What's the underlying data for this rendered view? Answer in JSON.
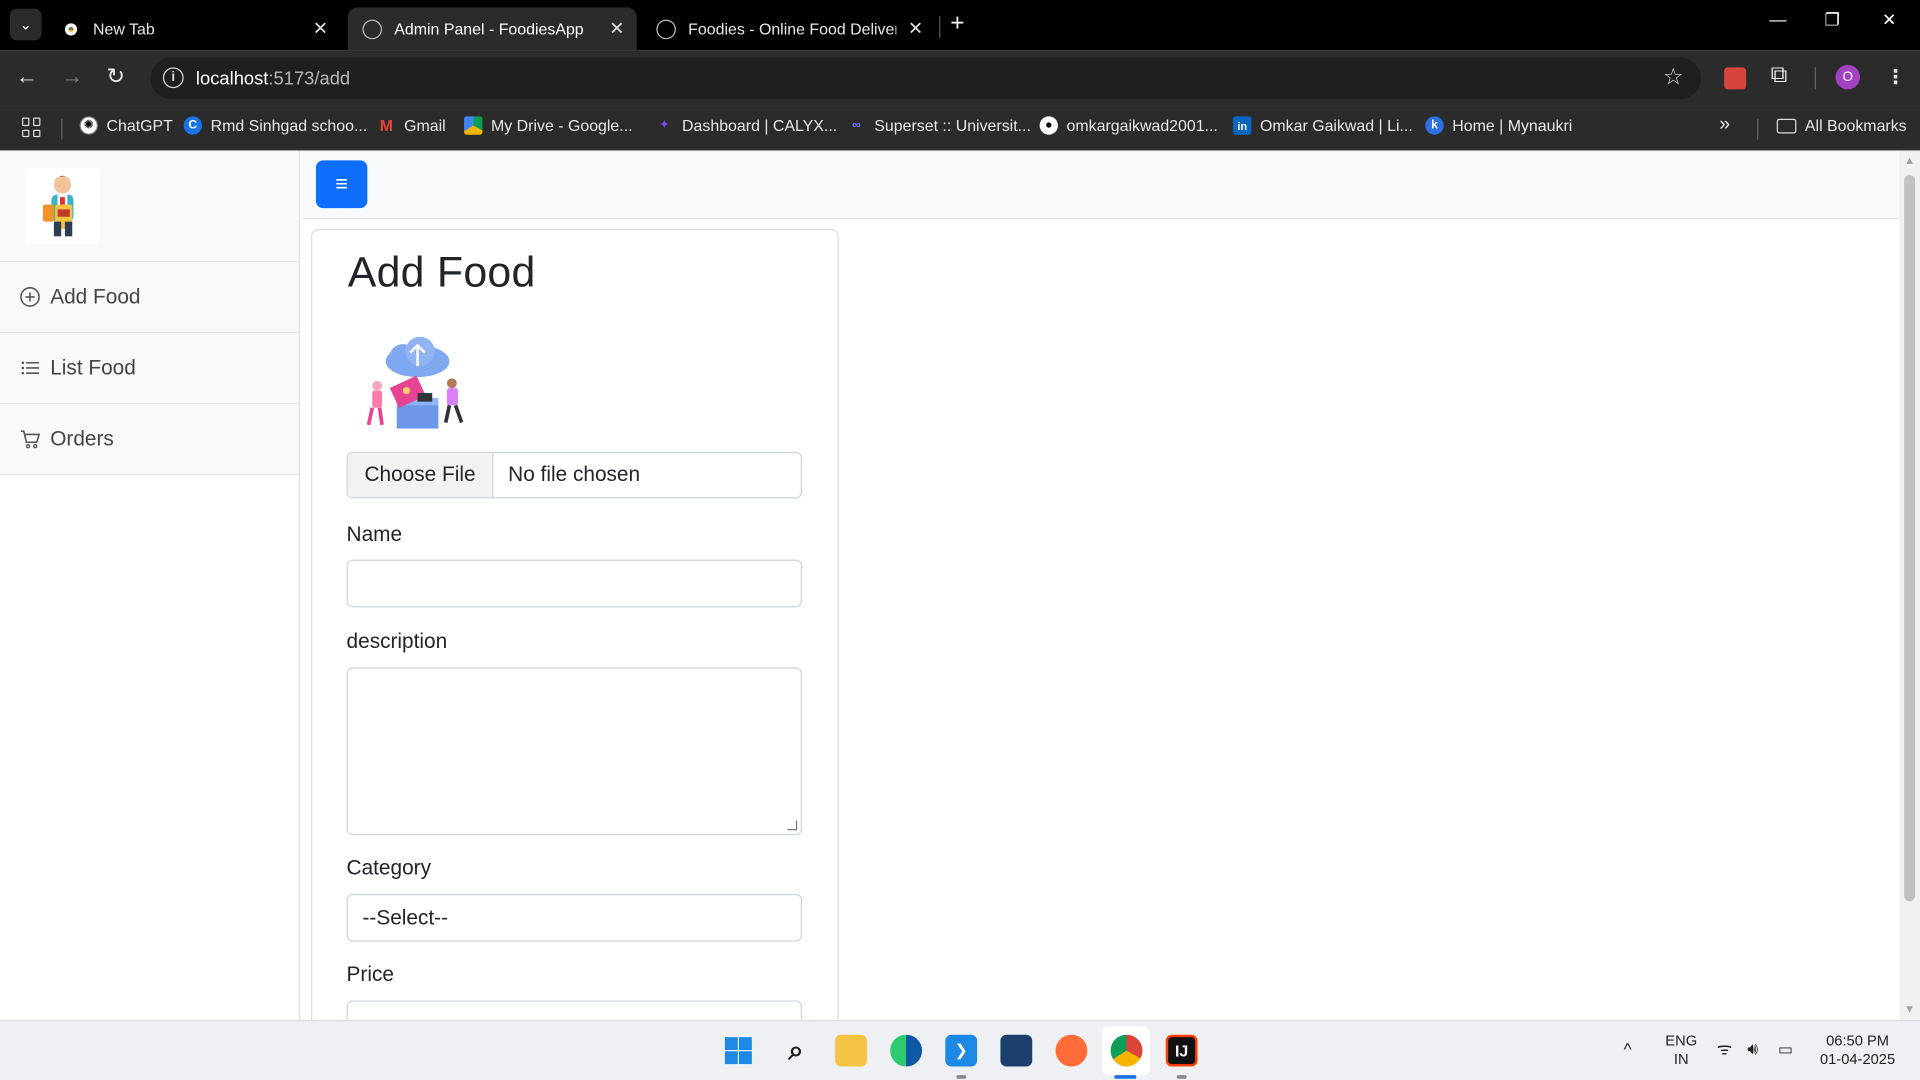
{
  "browser": {
    "tabs": [
      {
        "title": "New Tab",
        "favicon": "chrome-icon",
        "active": false
      },
      {
        "title": "Admin Panel - FoodiesApp",
        "favicon": "globe-icon",
        "active": true
      },
      {
        "title": "Foodies - Online Food Delivery",
        "favicon": "globe-icon",
        "active": false
      }
    ],
    "url_host": "localhost",
    "url_path": ":5173/add",
    "profile_initial": "O",
    "bookmarks": [
      {
        "label": "ChatGPT",
        "icon": "chatgpt-icon"
      },
      {
        "label": "Rmd Sinhgad schoo...",
        "icon": "c-letter-icon"
      },
      {
        "label": "Gmail",
        "icon": "gmail-icon"
      },
      {
        "label": "My Drive - Google...",
        "icon": "google-drive-icon"
      },
      {
        "label": "Dashboard | CALYX...",
        "icon": "calyx-icon"
      },
      {
        "label": "Superset :: Universit...",
        "icon": "superset-icon"
      },
      {
        "label": "omkargaikwad2001...",
        "icon": "github-icon"
      },
      {
        "label": "Omkar Gaikwad | Li...",
        "icon": "linkedin-icon"
      },
      {
        "label": "Home | Mynaukri",
        "icon": "mynaukri-icon"
      }
    ],
    "all_bookmarks_label": "All Bookmarks"
  },
  "sidebar": {
    "items": [
      {
        "label": "Add Food",
        "icon": "plus-circle-icon"
      },
      {
        "label": "List Food",
        "icon": "list-icon"
      },
      {
        "label": "Orders",
        "icon": "cart-icon"
      }
    ]
  },
  "form": {
    "title": "Add Food",
    "file_button": "Choose File",
    "file_status": "No file chosen",
    "name_label": "Name",
    "name_value": "",
    "description_label": "description",
    "description_value": "",
    "category_label": "Category",
    "category_selected": "--Select--",
    "price_label": "Price",
    "price_value": ""
  },
  "taskbar": {
    "lang_line1": "ENG",
    "lang_line2": "IN",
    "time": "06:50 PM",
    "date": "01-04-2025"
  },
  "colors": {
    "accent": "#0d6efd",
    "tab_strip": "#000000",
    "toolbar": "#2b2b2b"
  }
}
